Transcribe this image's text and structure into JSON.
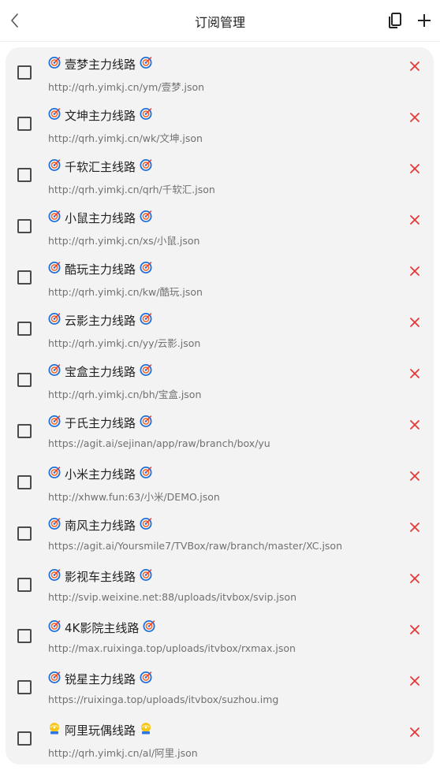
{
  "header": {
    "title": "订阅管理",
    "back_icon": "chevron-left-icon",
    "copy_icon": "copy-icon",
    "add_icon": "plus-icon"
  },
  "colors": {
    "delete": "#e53935",
    "list_bg": "#f3f3f3",
    "dart_blue": "#1e6fd9",
    "dart_orange": "#f0652a"
  },
  "subscriptions": [
    {
      "name": "壹梦主力线路",
      "url": "http://qrh.yimkj.cn/ym/壹梦.json",
      "icon": "dart-icon"
    },
    {
      "name": "文坤主力线路",
      "url": "http://qrh.yimkj.cn/wk/文坤.json",
      "icon": "dart-icon"
    },
    {
      "name": "千软汇主线路",
      "url": "http://qrh.yimkj.cn/qrh/千软汇.json",
      "icon": "dart-icon"
    },
    {
      "name": "小鼠主力线路",
      "url": "http://qrh.yimkj.cn/xs/小鼠.json",
      "icon": "dart-icon"
    },
    {
      "name": "酷玩主力线路",
      "url": "http://qrh.yimkj.cn/kw/酷玩.json",
      "icon": "dart-icon"
    },
    {
      "name": "云影主力线路",
      "url": "http://qrh.yimkj.cn/yy/云影.json",
      "icon": "dart-icon"
    },
    {
      "name": "宝盒主力线路",
      "url": "http://qrh.yimkj.cn/bh/宝盒.json",
      "icon": "dart-icon"
    },
    {
      "name": "于氏主力线路",
      "url": "https://agit.ai/sejinan/app/raw/branch/box/yu",
      "icon": "dart-icon"
    },
    {
      "name": "小米主力线路",
      "url": "http://xhww.fun:63/小米/DEMO.json",
      "icon": "dart-icon"
    },
    {
      "name": "南风主力线路",
      "url": "https://agit.ai/Yoursmile7/TVBox/raw/branch/master/XC.json",
      "icon": "dart-icon"
    },
    {
      "name": "影视车主线路",
      "url": "http://svip.weixine.net:88/uploads/itvbox/svip.json",
      "icon": "dart-icon"
    },
    {
      "name": "4K影院主线路",
      "url": "http://max.ruixinga.top/uploads/itvbox/rxmax.json",
      "icon": "dart-icon"
    },
    {
      "name": "锐星主力线路",
      "url": "https://ruixinga.top/uploads/itvbox/suzhou.img",
      "icon": "dart-icon"
    },
    {
      "name": "阿里玩偶线路",
      "url": "http://qrh.yimkj.cn/al/阿里.json",
      "icon": "dvd-icon"
    }
  ]
}
